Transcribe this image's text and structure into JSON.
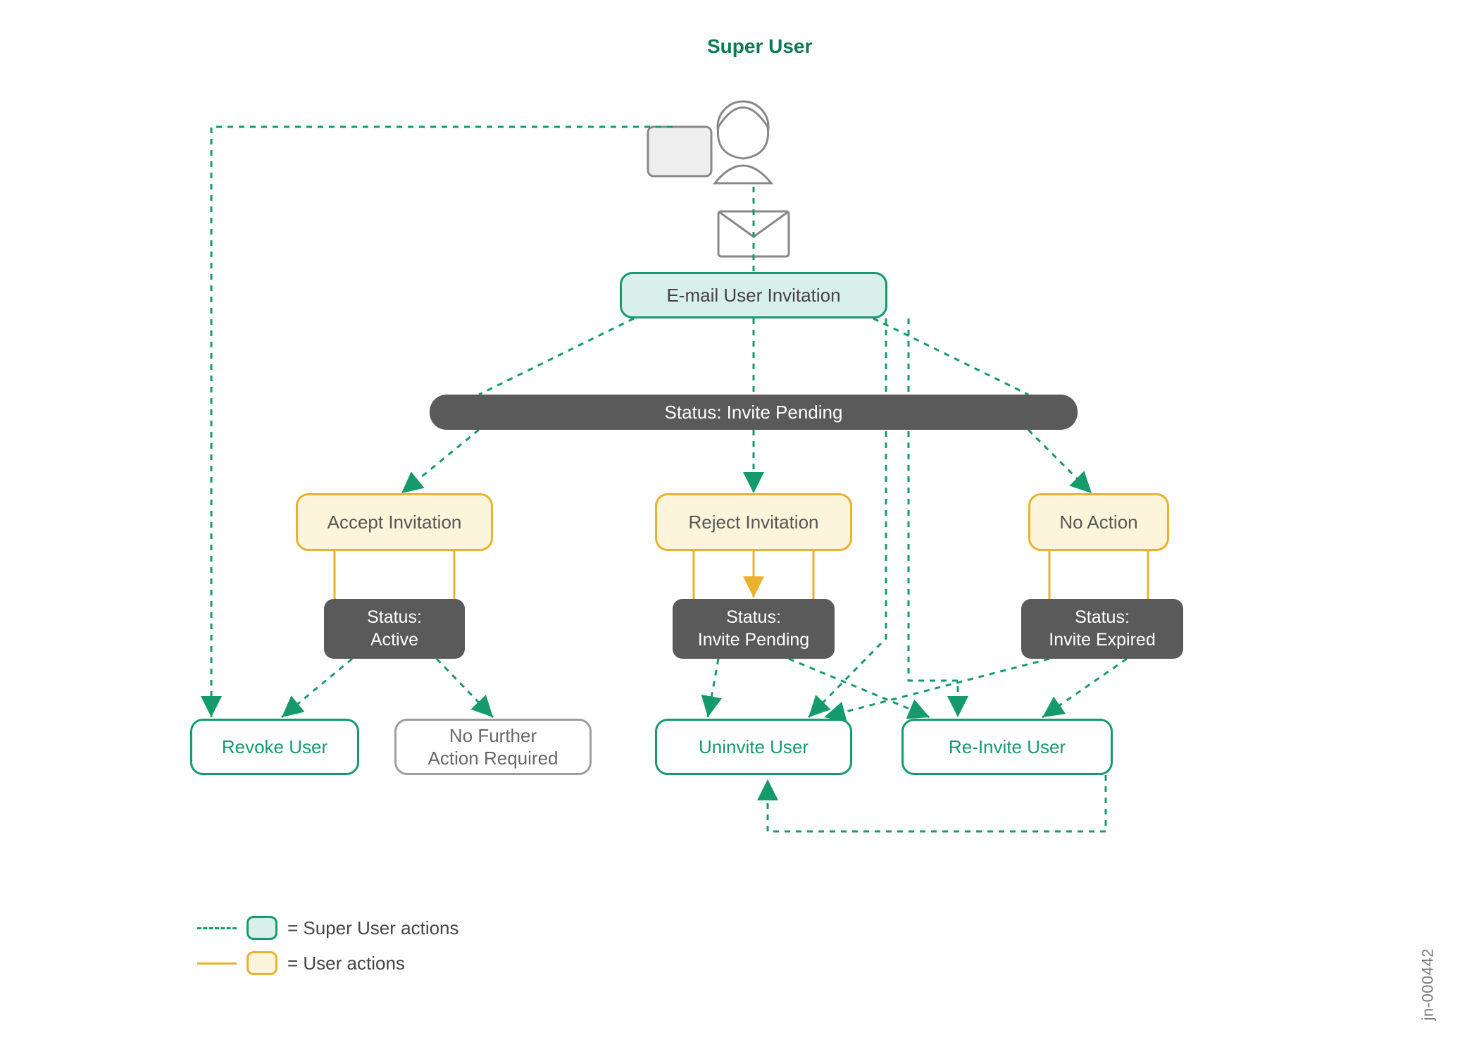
{
  "title": "Super User",
  "nodes": {
    "email_invite": "E-mail User Invitation",
    "status_pending_bar": "Status: Invite Pending",
    "accept": "Accept Invitation",
    "reject": "Reject Invitation",
    "no_action": "No Action",
    "status_active": "Status:\nActive",
    "status_pending2": "Status:\nInvite Pending",
    "status_expired": "Status:\nInvite Expired",
    "revoke": "Revoke User",
    "no_further": "No Further\nAction Required",
    "uninvite": "Uninvite User",
    "reinvite": "Re-Invite User"
  },
  "legend": {
    "super_user": "= Super User actions",
    "user": "= User actions"
  },
  "footnote": "jn-000442",
  "colors": {
    "green": "#159a6c",
    "yellow": "#e9b12c",
    "gray": "#5a5a5a"
  }
}
